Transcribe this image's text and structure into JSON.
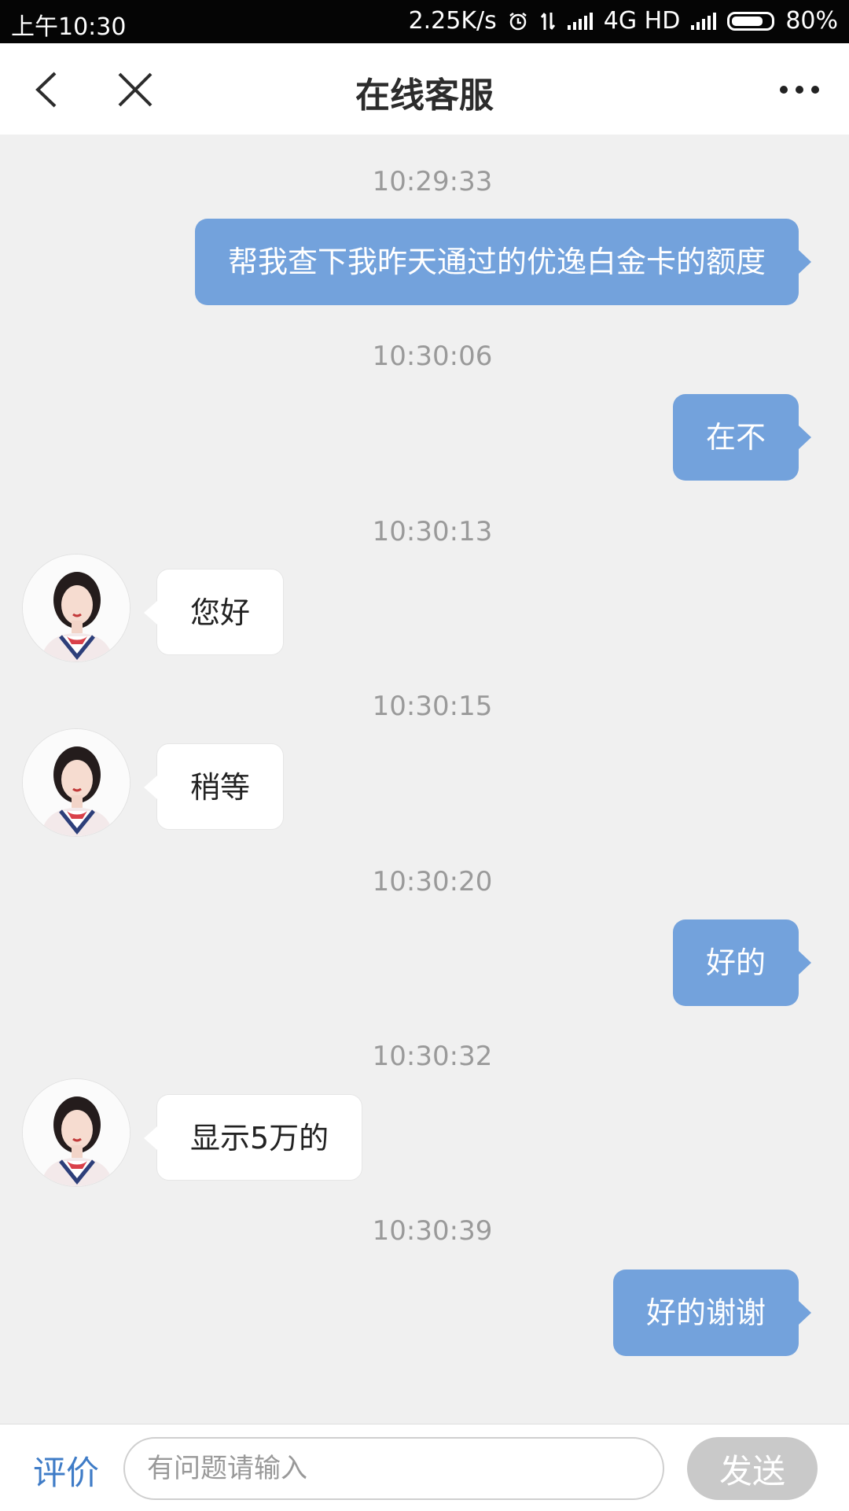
{
  "status_bar": {
    "time": "上午10:30",
    "speed": "2.25K/s",
    "network": "4G HD",
    "battery": "80%",
    "battery_level": 0.8
  },
  "header": {
    "back_icon": "chevron-left-icon",
    "close_icon": "close-icon",
    "title": "在线客服",
    "more_icon": "more-icon"
  },
  "messages": [
    {
      "time": "10:29:33",
      "sender": "me",
      "text": "帮我查下我昨天通过的优逸白金卡的额度"
    },
    {
      "time": "10:30:06",
      "sender": "me",
      "text": "在不"
    },
    {
      "time": "10:30:13",
      "sender": "agent",
      "text": "您好"
    },
    {
      "time": "10:30:15",
      "sender": "agent",
      "text": "稍等"
    },
    {
      "time": "10:30:20",
      "sender": "me",
      "text": "好的"
    },
    {
      "time": "10:30:32",
      "sender": "agent",
      "text": "显示5万的"
    },
    {
      "time": "10:30:39",
      "sender": "me",
      "text": "好的谢谢"
    }
  ],
  "composer": {
    "rate_label": "评价",
    "placeholder": "有问题请输入",
    "value": "",
    "send_label": "发送"
  },
  "colors": {
    "my_bubble": "#73a2dc",
    "accent": "#3f7cc7",
    "background": "#f0f0f0"
  }
}
